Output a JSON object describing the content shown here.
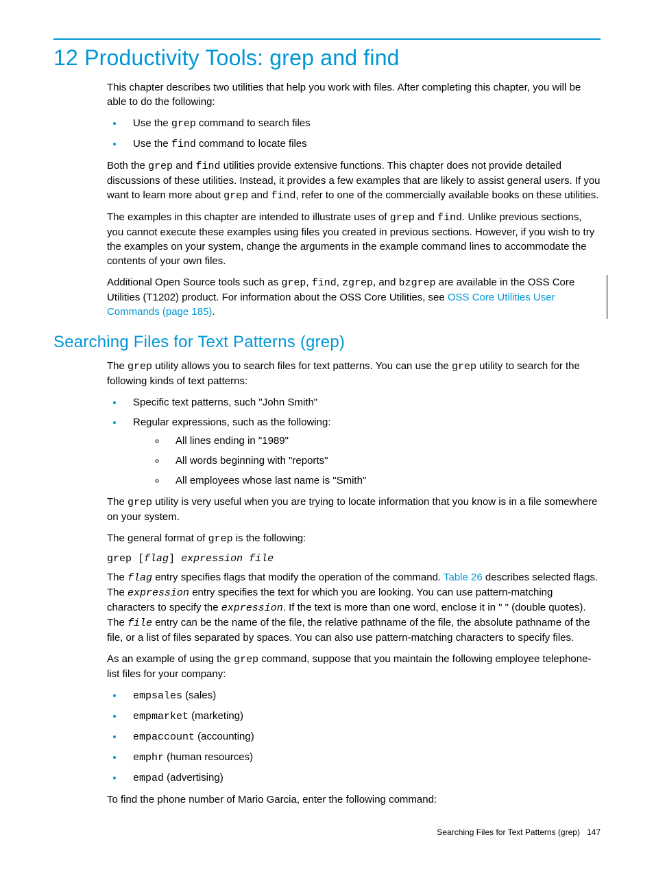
{
  "chapter_title": "12 Productivity Tools: grep and find",
  "intro": {
    "p1": "This chapter describes two utilities that help you work with files. After completing this chapter, you will be able to do the following:",
    "bullets": [
      {
        "prefix": "Use the ",
        "code": "grep",
        "suffix": " command to search files"
      },
      {
        "prefix": "Use the ",
        "code": "find",
        "suffix": " command to locate files"
      }
    ],
    "p2_pre": "Both the ",
    "p2_code1": "grep",
    "p2_mid1": " and ",
    "p2_code2": "find",
    "p2_mid2": " utilities provide extensive functions. This chapter does not provide detailed discussions of these utilities. Instead, it provides a few examples that are likely to assist general users. If you want to learn more about ",
    "p2_code3": "grep",
    "p2_mid3": " and ",
    "p2_code4": "find",
    "p2_suffix": ", refer to one of the commercially available books on these utilities.",
    "p3_pre": "The examples in this chapter are intended to illustrate uses of ",
    "p3_code1": "grep",
    "p3_mid1": " and ",
    "p3_code2": "find",
    "p3_suffix": ". Unlike previous sections, you cannot execute these examples using files you created in previous sections. However, if you wish to try the examples on your system, change the arguments in the example command lines to accommodate the contents of your own files.",
    "p4_pre": "Additional Open Source tools such as ",
    "p4_code1": "grep",
    "p4_mid1": ", ",
    "p4_code2": "find",
    "p4_mid2": ", ",
    "p4_code3": "zgrep",
    "p4_mid3": ", and ",
    "p4_code4": "bzgrep",
    "p4_mid4": " are available in the OSS Core Utilities (T1202) product. For information about the OSS Core Utilities, see ",
    "p4_link": "OSS Core Utilities User Commands (page 185)",
    "p4_suffix": "."
  },
  "section1": {
    "heading": "Searching Files for Text Patterns (grep)",
    "p1_pre": "The ",
    "p1_code1": "grep",
    "p1_mid1": " utility allows you to search files for text patterns. You can use the ",
    "p1_code2": "grep",
    "p1_suffix": " utility to search for the following kinds of text patterns:",
    "bullets1": [
      "Specific text patterns, such \"John Smith\"",
      "Regular expressions, such as the following:"
    ],
    "sub_bullets": [
      "All lines ending in \"1989\"",
      "All words beginning with \"reports\"",
      "All employees whose last name is \"Smith\""
    ],
    "p2_pre": "The ",
    "p2_code1": "grep",
    "p2_suffix": " utility is very useful when you are trying to locate information that you know is in a file somewhere on your system.",
    "p3_pre": "The general format of ",
    "p3_code1": "grep",
    "p3_suffix": " is the following:",
    "syntax_cmd": "grep",
    "syntax_open": " [",
    "syntax_flag": "flag",
    "syntax_close": "] ",
    "syntax_expr": "expression file",
    "p4_pre": "The ",
    "p4_flag": "flag",
    "p4_mid1": " entry specifies flags that modify the operation of the command. ",
    "p4_link": "Table 26",
    "p4_mid2": " describes selected flags. The ",
    "p4_expr": "expression",
    "p4_mid3": " entry specifies the text for which you are looking. You can use pattern-matching characters to specify the ",
    "p4_expr2": "expression",
    "p4_mid4": ". If the text is more than one word, enclose it in \" \" (double quotes). The ",
    "p4_file": "file",
    "p4_suffix": " entry can be the name of the file, the relative pathname of the file, the absolute pathname of the file, or a list of files separated by spaces. You can also use pattern-matching characters to specify files.",
    "p5_pre": "As an example of using the ",
    "p5_code1": "grep",
    "p5_suffix": " command, suppose that you maintain the following employee telephone-list files for your company:",
    "bullets2": [
      {
        "code": "empsales",
        "text": " (sales)"
      },
      {
        "code": "empmarket",
        "text": " (marketing)"
      },
      {
        "code": "empaccount",
        "text": " (accounting)"
      },
      {
        "code": "emphr",
        "text": " (human resources)"
      },
      {
        "code": "empad",
        "text": " (advertising)"
      }
    ],
    "p6": "To find the phone number of Mario Garcia, enter the following command:"
  },
  "footer": {
    "label": "Searching Files for Text Patterns (grep)",
    "page": "147"
  }
}
